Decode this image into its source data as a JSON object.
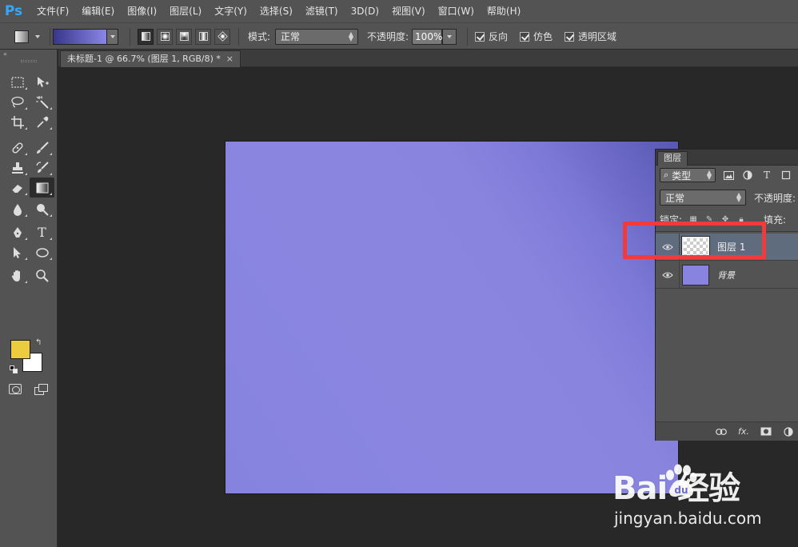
{
  "app": {
    "logo": "Ps",
    "menu": [
      "文件(F)",
      "编辑(E)",
      "图像(I)",
      "图层(L)",
      "文字(Y)",
      "选择(S)",
      "滤镜(T)",
      "3D(D)",
      "视图(V)",
      "窗口(W)",
      "帮助(H)"
    ]
  },
  "options_bar": {
    "mode_label": "模式:",
    "mode_value": "正常",
    "opacity_label": "不透明度:",
    "opacity_value": "100%",
    "reverse_label": "反向",
    "dither_label": "仿色",
    "transparency_label": "透明区域",
    "reverse_checked": true,
    "dither_checked": true,
    "transparency_checked": true
  },
  "toolbar": {
    "header_glyph": "«",
    "foreground_color": "#eccb3e",
    "background_color": "#ffffff"
  },
  "document": {
    "tab_title": "未标题-1 @ 66.7% (图层 1, RGB/8) *",
    "close_glyph": "×",
    "gradient_colors": [
      "#5758b1",
      "#8985de"
    ]
  },
  "layers_panel": {
    "tab_label": "图层",
    "filter_value": "类型",
    "filter_type_icon": "T",
    "blend_mode": "正常",
    "opacity_label": "不透明度:",
    "lock_label": "锁定:",
    "fill_label": "填充:",
    "footer_fx": "fx.",
    "layers": [
      {
        "name": "图层 1",
        "selected": true,
        "thumbnail": "transparent"
      },
      {
        "name": "背景",
        "selected": false,
        "thumbnail": "gradient"
      }
    ]
  },
  "annotation": {
    "highlight_color": "#ef3a3e"
  },
  "watermark": {
    "logo_text": "Bai  经验",
    "url": "jingyan.baidu.com"
  }
}
